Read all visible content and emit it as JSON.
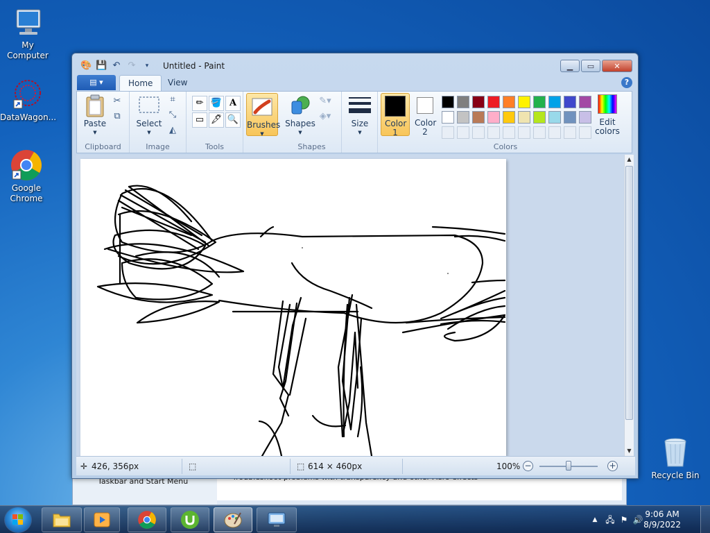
{
  "desktop": {
    "icons": [
      {
        "label": "My Computer"
      },
      {
        "label": "DataWagon..."
      },
      {
        "label": "Google Chrome"
      },
      {
        "label": "Recycle Bin"
      }
    ]
  },
  "background_window": {
    "left_text": "Taskbar and Start Menu",
    "right_text": "Troubleshoot problems with transparency and other Aero effects"
  },
  "paint": {
    "title": "Untitled - Paint",
    "tabs": [
      {
        "label": "Home",
        "active": true
      },
      {
        "label": "View",
        "active": false
      }
    ],
    "ribbon": {
      "groups": {
        "clipboard": {
          "label": "Clipboard",
          "paste": "Paste"
        },
        "image": {
          "label": "Image",
          "select": "Select"
        },
        "tools": {
          "label": "Tools"
        },
        "brushes": {
          "label": "Brushes"
        },
        "shapes": {
          "label": "Shapes",
          "shapes_btn": "Shapes"
        },
        "size": {
          "label": "Size"
        },
        "colors": {
          "label": "Colors",
          "color1": "Color 1",
          "color2": "Color 2",
          "edit_colors": "Edit colors",
          "palette_row1": [
            "#000000",
            "#7f7f7f",
            "#880015",
            "#ed1c24",
            "#ff7f27",
            "#fff200",
            "#22b14c",
            "#00a2e8",
            "#3f48cc",
            "#a349a4"
          ],
          "palette_row2": [
            "#ffffff",
            "#c3c3c3",
            "#b97a57",
            "#ffaec9",
            "#ffc90e",
            "#efe4b0",
            "#b5e61d",
            "#99d9ea",
            "#7092be",
            "#c8bfe7"
          ],
          "color1_value": "#000000",
          "color2_value": "#ffffff"
        }
      }
    },
    "status": {
      "cursor_pos": "426, 356px",
      "canvas_size": "614 × 460px",
      "zoom": "100%"
    }
  },
  "taskbar": {
    "time": "9:06 AM",
    "date": "8/9/2022"
  }
}
